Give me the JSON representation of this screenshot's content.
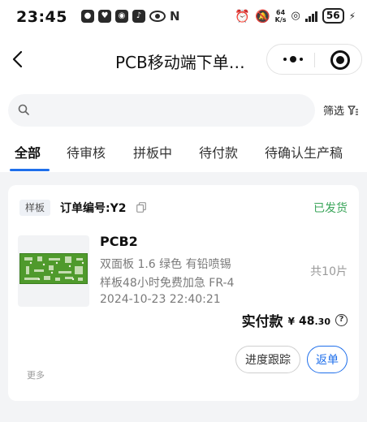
{
  "status_bar": {
    "time": "23:45",
    "speed_value": "64",
    "speed_unit": "K/s",
    "battery": "56",
    "nfc_letter": "N"
  },
  "nav": {
    "title": "PCB移动端下单…"
  },
  "search": {
    "placeholder": "",
    "value": ""
  },
  "filter": {
    "label": "筛选"
  },
  "tabs": [
    {
      "label": "全部",
      "active": true
    },
    {
      "label": "待审核",
      "active": false
    },
    {
      "label": "拼板中",
      "active": false
    },
    {
      "label": "待付款",
      "active": false
    },
    {
      "label": "待确认生产稿",
      "active": false
    }
  ],
  "order": {
    "tag": "样板",
    "order_no": "订单编号:Y2",
    "status": "已发货",
    "status_color": "#3aa55a",
    "product_name": "PCB2",
    "spec_line1": "双面板 1.6 绿色 有铅喷锡",
    "spec_line2": "样板48小时免费加急 FR-4",
    "date": "2024-10-23 22:40:21",
    "quantity": "共10片",
    "pay_label": "实付款",
    "currency": "¥",
    "amount_int": "48",
    "amount_dec": ".30",
    "help_symbol": "?",
    "more": "更多",
    "btn_track": "进度跟踪",
    "btn_return": "返单",
    "accent_color": "#1f6feb"
  }
}
